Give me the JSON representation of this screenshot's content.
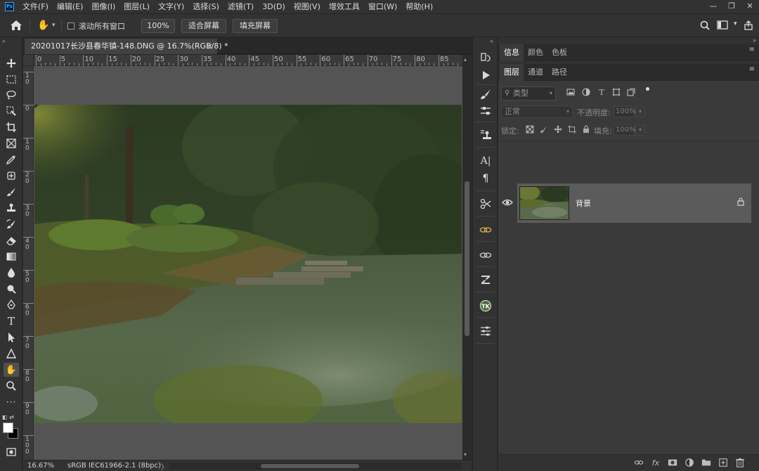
{
  "menu": {
    "logo": "Ps",
    "items": [
      "文件(F)",
      "编辑(E)",
      "图像(I)",
      "图层(L)",
      "文字(Y)",
      "选择(S)",
      "滤镜(T)",
      "3D(D)",
      "视图(V)",
      "增效工具",
      "窗口(W)",
      "帮助(H)"
    ]
  },
  "window_controls": {
    "minimize": "—",
    "restore": "❐",
    "close": "✕"
  },
  "options": {
    "scroll_all_windows": "滚动所有窗口",
    "scroll_all_checked": false,
    "zoom_button": "100%",
    "fit_screen": "适合屏幕",
    "fill_screen": "填充屏幕"
  },
  "document": {
    "tab_title": "20201017长沙县春华镇-148.DNG @ 16.7%(RGB/8) *",
    "close_glyph": "×"
  },
  "rulers": {
    "horizontal": [
      "0",
      "5",
      "10",
      "15",
      "20",
      "25",
      "30",
      "35",
      "40",
      "45",
      "50",
      "55",
      "60",
      "65",
      "70",
      "75",
      "80",
      "85"
    ],
    "vertical": [
      "1\n0",
      "0",
      "1\n0",
      "2\n0",
      "3\n0",
      "4\n0",
      "5\n0",
      "6\n0",
      "7\n0",
      "8\n0",
      "9\n0",
      "1\n0\n0"
    ]
  },
  "status": {
    "zoom": "16.67%",
    "profile": "sRGB IEC61966-2.1 (8bpc)",
    "arrow": "〉"
  },
  "panels": {
    "top_tabs": [
      "信息",
      "颜色",
      "色板"
    ],
    "layer_tabs": [
      "图层",
      "通道",
      "路径"
    ],
    "filter_kind": "类型",
    "blend_mode": "正常",
    "opacity_label": "不透明度:",
    "opacity_value": "100%",
    "lock_label": "锁定:",
    "fill_label": "填充:",
    "fill_value": "100%",
    "layers": [
      {
        "name": "背景",
        "visible": true,
        "locked": true
      }
    ]
  },
  "colors": {
    "foreground": "#ffffff",
    "background": "#000000",
    "selected_layer": "#5b5b5b"
  },
  "icons": {
    "toolbar": [
      "move-icon",
      "marquee-icon",
      "lasso-icon",
      "quick-select-icon",
      "crop-icon",
      "frame-icon",
      "eyedropper-icon",
      "healing-brush-icon",
      "brush-icon",
      "clone-stamp-icon",
      "history-brush-icon",
      "eraser-icon",
      "gradient-icon",
      "blur-icon",
      "dodge-icon",
      "pen-icon",
      "type-icon",
      "path-select-icon",
      "shape-icon",
      "hand-icon",
      "zoom-icon",
      "more-tools-icon"
    ]
  }
}
